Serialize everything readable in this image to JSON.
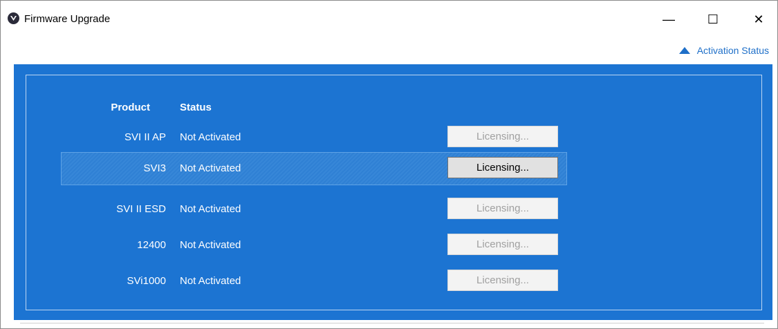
{
  "window": {
    "title": "Firmware Upgrade",
    "icon": "app-logo-icon",
    "controls": {
      "minimize": "—",
      "maximize": "☐",
      "close": "✕"
    }
  },
  "activation_toggle": {
    "label": "Activation Status",
    "icon": "triangle-up-icon"
  },
  "table": {
    "headers": {
      "product": "Product",
      "status": "Status"
    },
    "rows": [
      {
        "product": "SVI II AP",
        "status": "Not Activated",
        "button": "Licensing...",
        "enabled": false,
        "selected": false
      },
      {
        "product": "SVI3",
        "status": "Not Activated",
        "button": "Licensing...",
        "enabled": true,
        "selected": true
      },
      {
        "product": "SVI II ESD",
        "status": "Not Activated",
        "button": "Licensing...",
        "enabled": false,
        "selected": false
      },
      {
        "product": "12400",
        "status": "Not Activated",
        "button": "Licensing...",
        "enabled": false,
        "selected": false
      },
      {
        "product": "SVi1000",
        "status": "Not Activated",
        "button": "Licensing...",
        "enabled": false,
        "selected": false
      }
    ]
  },
  "colors": {
    "panel_blue": "#1c74d2",
    "link_blue": "#1e6fc8"
  }
}
